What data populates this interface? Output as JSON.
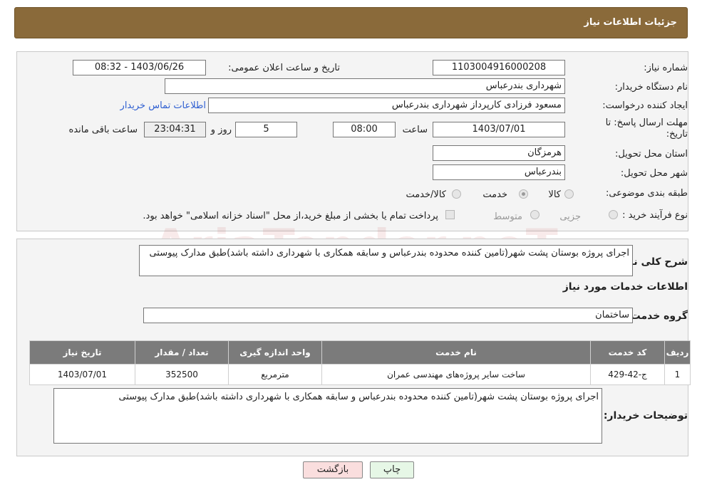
{
  "header": {
    "title": "جزئیات اطلاعات نیاز"
  },
  "form": {
    "need_number": {
      "label": "شماره نیاز:",
      "value": "1103004916000208"
    },
    "announce_datetime": {
      "label": "تاریخ و ساعت اعلان عمومی:",
      "value": "1403/06/26 - 08:32"
    },
    "buyer_org": {
      "label": "نام دستگاه خریدار:",
      "value": "شهرداری بندرعباس"
    },
    "requester": {
      "label": "ایجاد کننده درخواست:",
      "value": "مسعود فرزادی کارپرداز شهرداری بندرعباس",
      "contact_link": "اطلاعات تماس خریدار"
    },
    "deadline": {
      "label_line1": "مهلت ارسال پاسخ: تا",
      "label_line2": "تاریخ:",
      "date": "1403/07/01",
      "time_label": "ساعت",
      "time": "08:00",
      "days": "5",
      "days_label": "روز و",
      "remaining": "23:04:31",
      "remaining_label": "ساعت باقی مانده"
    },
    "province": {
      "label": "استان محل تحویل:",
      "value": "هرمزگان"
    },
    "city": {
      "label": "شهر محل تحویل:",
      "value": "بندرعباس"
    },
    "category": {
      "label": "طبقه بندی موضوعی:",
      "options": [
        {
          "label": "کالا",
          "checked": false
        },
        {
          "label": "خدمت",
          "checked": true
        },
        {
          "label": "کالا/خدمت",
          "checked": false
        }
      ]
    },
    "purchase_type": {
      "label": "نوع فرآیند خرید :",
      "options": [
        {
          "label": "جزیی",
          "checked": false
        },
        {
          "label": "متوسط",
          "checked": false
        }
      ],
      "payment_note": "پرداخت تمام یا بخشی از مبلغ خرید،از محل \"اسناد خزانه اسلامی\" خواهد بود."
    }
  },
  "details": {
    "summary_label": "شرح کلی نیاز:",
    "summary": "اجرای پروژه بوستان پشت شهر(تامین کننده محدوده بندرعباس و سابقه همکاری با شهرداری داشته باشد)طبق مدارک پیوستی",
    "services_title": "اطلاعات خدمات مورد نیاز",
    "service_group_label": "گروه خدمت:",
    "service_group": "ساختمان",
    "table": {
      "columns": [
        "ردیف",
        "کد خدمت",
        "نام خدمت",
        "واحد اندازه گیری",
        "تعداد / مقدار",
        "تاریخ نیاز"
      ],
      "rows": [
        [
          "1",
          "ج-42-429",
          "ساخت سایر پروژه‌های مهندسی عمران",
          "مترمربع",
          "352500",
          "1403/07/01"
        ]
      ]
    },
    "buyer_notes_label": "توضیحات خریدار:",
    "buyer_notes": "اجرای پروژه بوستان پشت شهر(تامین کننده محدوده بندرعباس و سابقه همکاری با شهرداری داشته باشد)طبق مدارک پیوستی"
  },
  "buttons": {
    "print": "چاپ",
    "back": "بازگشت"
  },
  "watermark": "AriaTender.neT",
  "colors": {
    "header_bg": "#8a6a3a",
    "table_header_bg": "#7b7b7b",
    "link": "#2f5fd1",
    "back_btn_bg": "#fadede",
    "print_btn_bg": "#e6f7e6"
  }
}
